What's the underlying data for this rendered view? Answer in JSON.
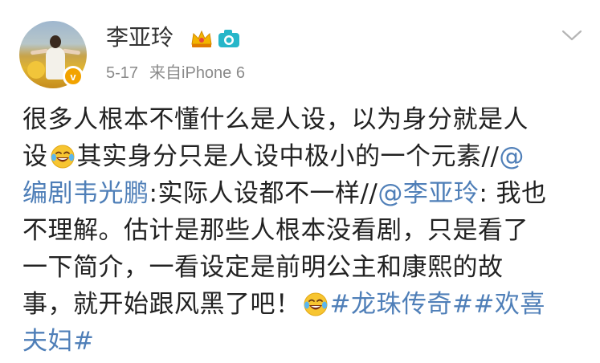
{
  "user": {
    "name": "李亚玲",
    "verified_icon": "verified-v-icon",
    "verified_label": "v",
    "badge_icons": [
      "crown-member-icon",
      "camera-icon"
    ]
  },
  "meta": {
    "date": "5-17",
    "source": "来自iPhone 6"
  },
  "menu": {
    "icon": "chevron-down-icon"
  },
  "post": {
    "lines": [
      [
        {
          "t": "很多人根本不懂什么是人设，以为身分就是人"
        }
      ],
      [
        {
          "t": "设"
        },
        {
          "emoji": "laughing-tears-emoji"
        },
        {
          "t": "其实身分只是人设中极小的一个元素//"
        },
        {
          "link": "@"
        }
      ],
      [
        {
          "link": "编剧韦光鹏"
        },
        {
          "t": ":实际人设都不一样//"
        },
        {
          "link": "@李亚玲"
        },
        {
          "t": ": 我也"
        }
      ],
      [
        {
          "t": "不理解。估计是那些人根本没看剧，只是看了"
        }
      ],
      [
        {
          "t": "一下简介，一看设定是前明公主和康熙的故"
        }
      ],
      [
        {
          "t": "事，就开始跟风黑了吧！"
        },
        {
          "emoji": "laughing-tears-emoji"
        },
        {
          "link": "#龙珠传奇##欢喜"
        }
      ],
      [
        {
          "link": "夫妇#"
        }
      ]
    ]
  },
  "colors": {
    "link": "#4f7fb8",
    "meta": "#8a8a8a",
    "text": "#222222",
    "verified": "#f2a300"
  }
}
